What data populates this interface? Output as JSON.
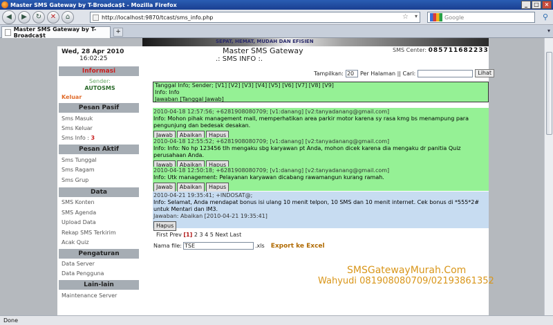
{
  "browser": {
    "window_title": "Master SMS Gateway by T-Broadca$t - Mozilla Firefox",
    "url": "http://localhost:9870/tcast/sms_info.php",
    "search_placeholder": "Google",
    "tab_label": "Master SMS Gateway by T-Broadca$t",
    "status_text": "Done"
  },
  "banner_text": "SEPAT, HEMAT, MUDAH DAN EFISIEN",
  "header": {
    "date": "Wed, 28 Apr 2010",
    "time": "16:02:25",
    "title": "Master SMS Gateway",
    "sms_center_label": "SMS Center:",
    "sms_center_number": "085711682233"
  },
  "sidebar": {
    "informasi": "Informasi",
    "sender_label": "Sender:",
    "sender_value": "AUTOSMS",
    "keluar": "Keluar",
    "pesan_pasif": "Pesan Pasif",
    "sms_masuk": "Sms Masuk",
    "sms_keluar": "Sms Keluar",
    "sms_info": "Sms Info :",
    "sms_info_count": "3",
    "pesan_aktif": "Pesan Aktif",
    "sms_tunggal": "Sms Tunggal",
    "sms_ragam": "Sms Ragam",
    "sms_grup": "Sms Grup",
    "data": "Data",
    "sms_konten": "SMS Konten",
    "sms_agenda": "SMS Agenda",
    "upload_data": "Upload Data",
    "rekap_sms": "Rekap SMS Terkirim",
    "acak_quiz": "Acak Quiz",
    "pengaturan": "Pengaturan",
    "data_server": "Data Server",
    "data_pengguna": "Data Pengguna",
    "lain_lain": "Lain-lain",
    "maintenance": "Maintenance Server"
  },
  "main": {
    "title": ".: SMS INFO :.",
    "tampilkan_label": "Tampilkan:",
    "tampilkan_value": "20",
    "per_halaman": "Per Halaman || Cari:",
    "lihat": "Lihat",
    "legend_line1": "Tanggal Info; Sender; [V1] [V2] [V3] [V4] [V5] [V6] [V7] [V8] [V9]",
    "legend_info_label": "Info:",
    "legend_info_value": "Info",
    "legend_line3": "Jawaban [Tanggal Jawab]",
    "messages": [
      {
        "header": "2010-04-18 12:57:56; +6281908080709; [v1:danang] [v2:tanyadanang@gmail.com]",
        "info_label": "Info:",
        "info": "Mohon pihak management mall, memperhatikan area parkir motor karena sy rasa kmg bs menampung para pengunjung dan bedesak desakan.",
        "btn_jawab": "Jawab",
        "btn_abaikan": "Abaikan",
        "btn_hapus": "Hapus"
      },
      {
        "header": "2010-04-18 12:55:52; +6281908080709; [v1:danang] [v2:tanyadanang@gmail.com]",
        "info_label": "Info:",
        "info": "Info: No hp 123456 tlh mengaku sbg karyawan pt Anda, mohon dicek karena dia mengaku dr panitia Quiz perusahaan Anda.",
        "btn_jawab": "Jawab",
        "btn_abaikan": "Abaikan",
        "btn_hapus": "Hapus"
      },
      {
        "header": "2010-04-18 12:50:18; +6281908080709; [v1:danang] [v2:tanyadanang@gmail.com]",
        "info_label": "Info:",
        "info": "Utk management: Pelayanan karyawan dicabang rawamangun kurang ramah.",
        "btn_jawab": "Jawab",
        "btn_abaikan": "Abaikan",
        "btn_hapus": "Hapus"
      },
      {
        "header": "2010-04-21 19:35:41; +INDOSAT@;",
        "info_label": "Info:",
        "info": "Selamat, Anda mendapat bonus isi ulang 10 menit telpon, 10 SMS dan 10 menit internet. Cek bonus di *555*2# untuk Mentari dan IM3.",
        "jawaban": "Jawaban: Abaikan [2010-04-21 19:35:41]",
        "btn_hapus": "Hapus"
      }
    ],
    "pager_first_prev": "First Prev",
    "pager_current": "[1]",
    "pager_rest": "2 3 4 5 Next Last",
    "nama_file_label": "Nama file:",
    "nama_file_value": "TSE",
    "xls_suffix": ".xls",
    "export": "Export ke Excel",
    "watermark1": "SMSGatewayMurah.Com",
    "watermark2": "Wahyudi 081908080709/02193861352"
  }
}
